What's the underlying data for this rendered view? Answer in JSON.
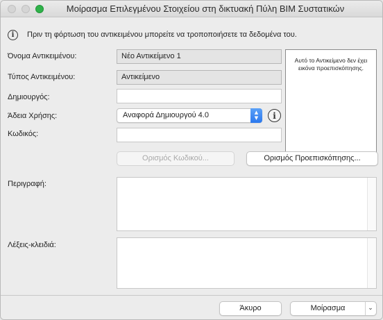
{
  "window": {
    "title": "Μοίρασμα Επιλεγμένου Στοιχείου στη δικτυακή Πύλη BIM Συστατικών"
  },
  "info": {
    "icon": "info-icon",
    "text": "Πριν τη φόρτωση του αντικειμένου μπορείτε να τροποποιήσετε τα δεδομένα του."
  },
  "form": {
    "object_name_label": "Όνομα Αντικειμένου:",
    "object_name_value": "Νέο Αντικείμενο 1",
    "object_type_label": "Τύπος Αντικειμένου:",
    "object_type_value": "Αντικείμενο",
    "creator_label": "Δημιουργός:",
    "creator_value": "",
    "license_label": "Άδεια Χρήσης:",
    "license_value": "Αναφορά Δημιουργού 4.0",
    "code_label": "Κωδικός:",
    "code_value": "",
    "description_label": "Περιγραφή:",
    "keywords_label": "Λέξεις-κλειδιά:"
  },
  "preview": {
    "message": "Αυτό το Αντικείμενο δεν έχει εικόνα προεπισκόπησης."
  },
  "buttons": {
    "set_code": "Ορισμός Κωδικού...",
    "set_preview": "Ορισμός Προεπισκόπησης...",
    "cancel": "Άκυρο",
    "share": "Μοίρασμα"
  },
  "colors": {
    "accent": "#2b78ee",
    "zoom_button": "#2fb24a"
  }
}
